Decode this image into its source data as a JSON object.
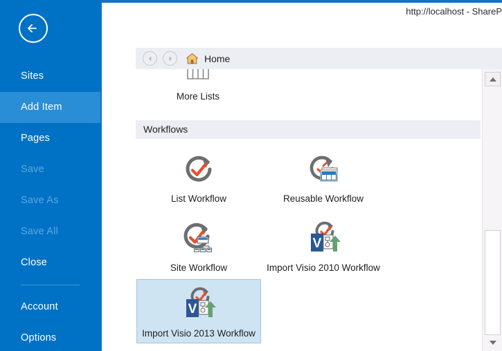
{
  "window": {
    "title": "http://localhost - ShareP",
    "back_icon": "back-arrow-icon"
  },
  "sidebar": {
    "items": [
      {
        "label": "Sites",
        "state": "normal"
      },
      {
        "label": "Add Item",
        "state": "selected"
      },
      {
        "label": "Pages",
        "state": "normal"
      },
      {
        "label": "Save",
        "state": "disabled"
      },
      {
        "label": "Save As",
        "state": "disabled"
      },
      {
        "label": "Save All",
        "state": "disabled"
      },
      {
        "label": "Close",
        "state": "normal"
      }
    ],
    "footer_items": [
      {
        "label": "Account",
        "state": "normal"
      },
      {
        "label": "Options",
        "state": "normal"
      }
    ]
  },
  "breadcrumb": {
    "back_icon": "nav-back-icon",
    "forward_icon": "nav-forward-icon",
    "home_icon": "home-icon",
    "label": "Home"
  },
  "content": {
    "partial_tile": {
      "label": "More Lists",
      "icon": "more-lists-icon"
    },
    "group_header": "Workflows",
    "tiles": [
      {
        "label": "List Workflow",
        "icon": "list-workflow-icon",
        "selected": false
      },
      {
        "label": "Reusable Workflow",
        "icon": "reusable-workflow-icon",
        "selected": false
      },
      {
        "label": "Site Workflow",
        "icon": "site-workflow-icon",
        "selected": false
      },
      {
        "label": "Import Visio 2010 Workflow",
        "icon": "import-visio-2010-icon",
        "selected": false
      },
      {
        "label": "Import Visio 2013 Workflow",
        "icon": "import-visio-2013-icon",
        "selected": true
      }
    ]
  },
  "scrollbar": {
    "up_icon": "scroll-up-icon",
    "down_icon": "scroll-down-icon",
    "thumb": "scroll-thumb"
  },
  "colors": {
    "sidebar_blue": "#0072c6",
    "sidebar_selected": "#2a8ed6",
    "sidebar_disabled_text": "#5ea7da",
    "window_border": "#1473c4",
    "header_band": "#eceef4",
    "tile_selected_bg": "#cfe4f2",
    "tile_selected_border": "#9fc5e0",
    "workflow_gray": "#6d6e71",
    "workflow_check": "#e8512a",
    "visio_blue": "#2b5797",
    "import_green": "#64a070"
  }
}
